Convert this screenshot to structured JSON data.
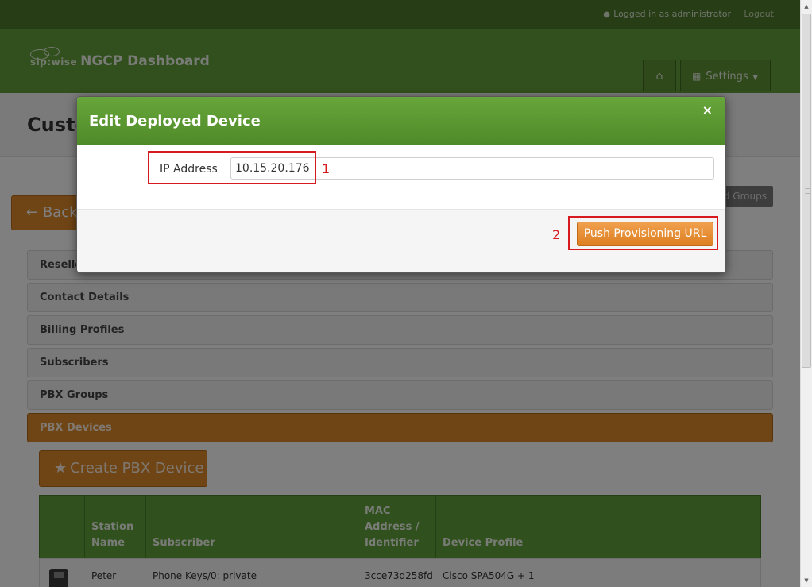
{
  "topbar": {
    "user_icon": "user-icon",
    "logged_in": "Logged in as administrator",
    "logout": "Logout"
  },
  "navbar": {
    "brand_logo": "sip:wise",
    "brand_title": "NGCP Dashboard",
    "home_icon": "home-icon",
    "settings_label": "Settings"
  },
  "page": {
    "title": "Custo",
    "back_label": "Back",
    "groups_label": "d Groups",
    "panels": [
      {
        "label": "Reseller"
      },
      {
        "label": "Contact Details"
      },
      {
        "label": "Billing Profiles"
      },
      {
        "label": "Subscribers"
      },
      {
        "label": "PBX Groups"
      },
      {
        "label": "PBX Devices"
      }
    ],
    "create_label": "Create PBX Device",
    "table": {
      "headers": [
        {
          "line1": "",
          "line2": "",
          "line3": ""
        },
        {
          "line1": "",
          "line2": "Station",
          "line3": "Name"
        },
        {
          "line1": "",
          "line2": "",
          "line3": "Subscriber"
        },
        {
          "line1": "MAC",
          "line2": "Address /",
          "line3": "Identifier"
        },
        {
          "line1": "",
          "line2": "",
          "line3": "Device Profile"
        },
        {
          "line1": "",
          "line2": "",
          "line3": ""
        }
      ],
      "rows": [
        {
          "station": "Peter",
          "subscriber": "Phone Keys/0: private",
          "mac": "3cce73d258fd",
          "profile": "Cisco SPA504G + 1"
        }
      ]
    }
  },
  "modal": {
    "title": "Edit Deployed Device",
    "close": "×",
    "ip_label": "IP Address",
    "ip_value": "10.15.20.176",
    "step1": "1",
    "step2": "2",
    "push_label": "Push Provisioning URL"
  },
  "colors": {
    "brand_green": "#63a03a",
    "accent_orange": "#e18b2d",
    "annotation_red": "#d71920"
  }
}
